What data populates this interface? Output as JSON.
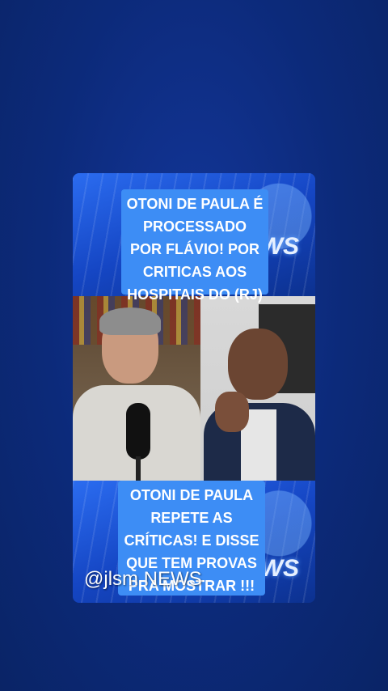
{
  "caption_top": "OTONI DE PAULA É PROCESSADO POR FLÁVIO! POR CRITICAS AOS HOSPITAIS DO (RJ)",
  "caption_bottom": "OTONI DE PAULA REPETE AS CRÍTICAS! E DISSE QUE TEM PROVAS PRA MOSTRAR !!!",
  "news_label": "NEWS",
  "watermark": "@jlsm NEWS",
  "colors": {
    "background": "#0d2a7c",
    "caption_bg": "#3d8df5"
  }
}
